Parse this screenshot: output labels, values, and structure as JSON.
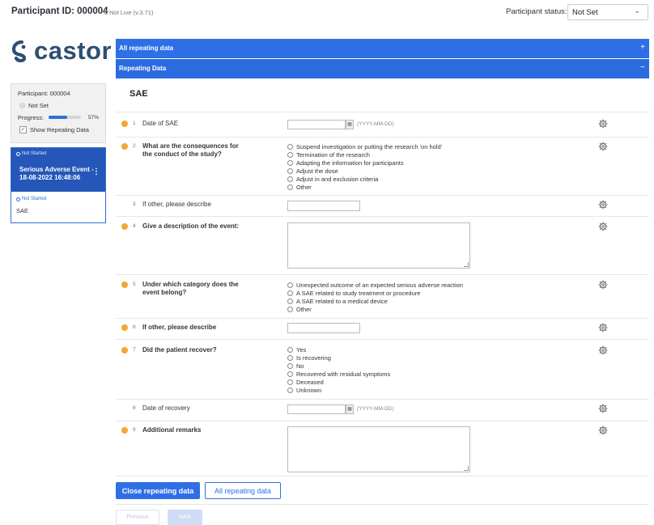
{
  "header": {
    "participant_id": "Participant ID: 000004",
    "environment": "Not Live (v.3.71)",
    "status_label": "Participant status:",
    "status_value": "Not Set"
  },
  "logo": {
    "text": "castor"
  },
  "participant_box": {
    "participant": "Participant: 000004",
    "status": "Not Set",
    "progress_label": "Progress:",
    "progress_value": "57%",
    "progress_fraction": 0.57,
    "show_repeating": "Show Repeating Data",
    "show_repeating_checked": true
  },
  "event_card": {
    "status": "Not Started",
    "title": "Serious Adverse Event - 18-08-2022 16:48:06",
    "form_status": "Not Started",
    "form_name": "SAE",
    "menu": "⋮"
  },
  "bars": {
    "all_repeating": {
      "label": "All repeating data",
      "sign": "+"
    },
    "repeating": {
      "label": "Repeating Data",
      "sign": "−"
    }
  },
  "form": {
    "title": "SAE",
    "date_hint": "(YYYY-MM-DD)",
    "fields": [
      {
        "num": "1",
        "label": "Date of SAE",
        "required": true
      },
      {
        "num": "2",
        "label": "What are the consequences for the conduct of the study?",
        "required": true,
        "options": [
          "Suspend investigation or putting the research 'on hold'",
          "Termination of the research",
          "Adapting the information for participants",
          "Adjust the dose",
          "Adjust in and exclusion criteria",
          "Other"
        ]
      },
      {
        "num": "3",
        "label": "If other, please describe",
        "required": false
      },
      {
        "num": "4",
        "label": "Give a description of the event:",
        "required": true
      },
      {
        "num": "5",
        "label": "Under which category does the event belong?",
        "required": true,
        "options": [
          "Unexpected outcome of an expected serious adverse reaction",
          "A SAE related to study treatment or procedure",
          "A SAE related to a medical device",
          "Other"
        ]
      },
      {
        "num": "6",
        "label": "If other, please describe",
        "required": true
      },
      {
        "num": "7",
        "label": "Did the patient recover?",
        "required": true,
        "options": [
          "Yes",
          "Is recovering",
          "No",
          "Recovered with residual symptoms",
          "Deceased",
          "Unknown"
        ]
      },
      {
        "num": "8",
        "label": "Date of recovery",
        "required": false
      },
      {
        "num": "9",
        "label": "Additional remarks",
        "required": true
      }
    ]
  },
  "buttons": {
    "close": "Close repeating data",
    "all": "All repeating data",
    "previous": "Previous",
    "next": "Next"
  },
  "colors": {
    "primary": "#2f6fe6",
    "required_dot": "#f4a533",
    "logo": "#2e4e73"
  },
  "icons": {
    "gear": "gear-icon",
    "calendar": "calendar-icon",
    "chevron": "chevron-down-icon"
  }
}
